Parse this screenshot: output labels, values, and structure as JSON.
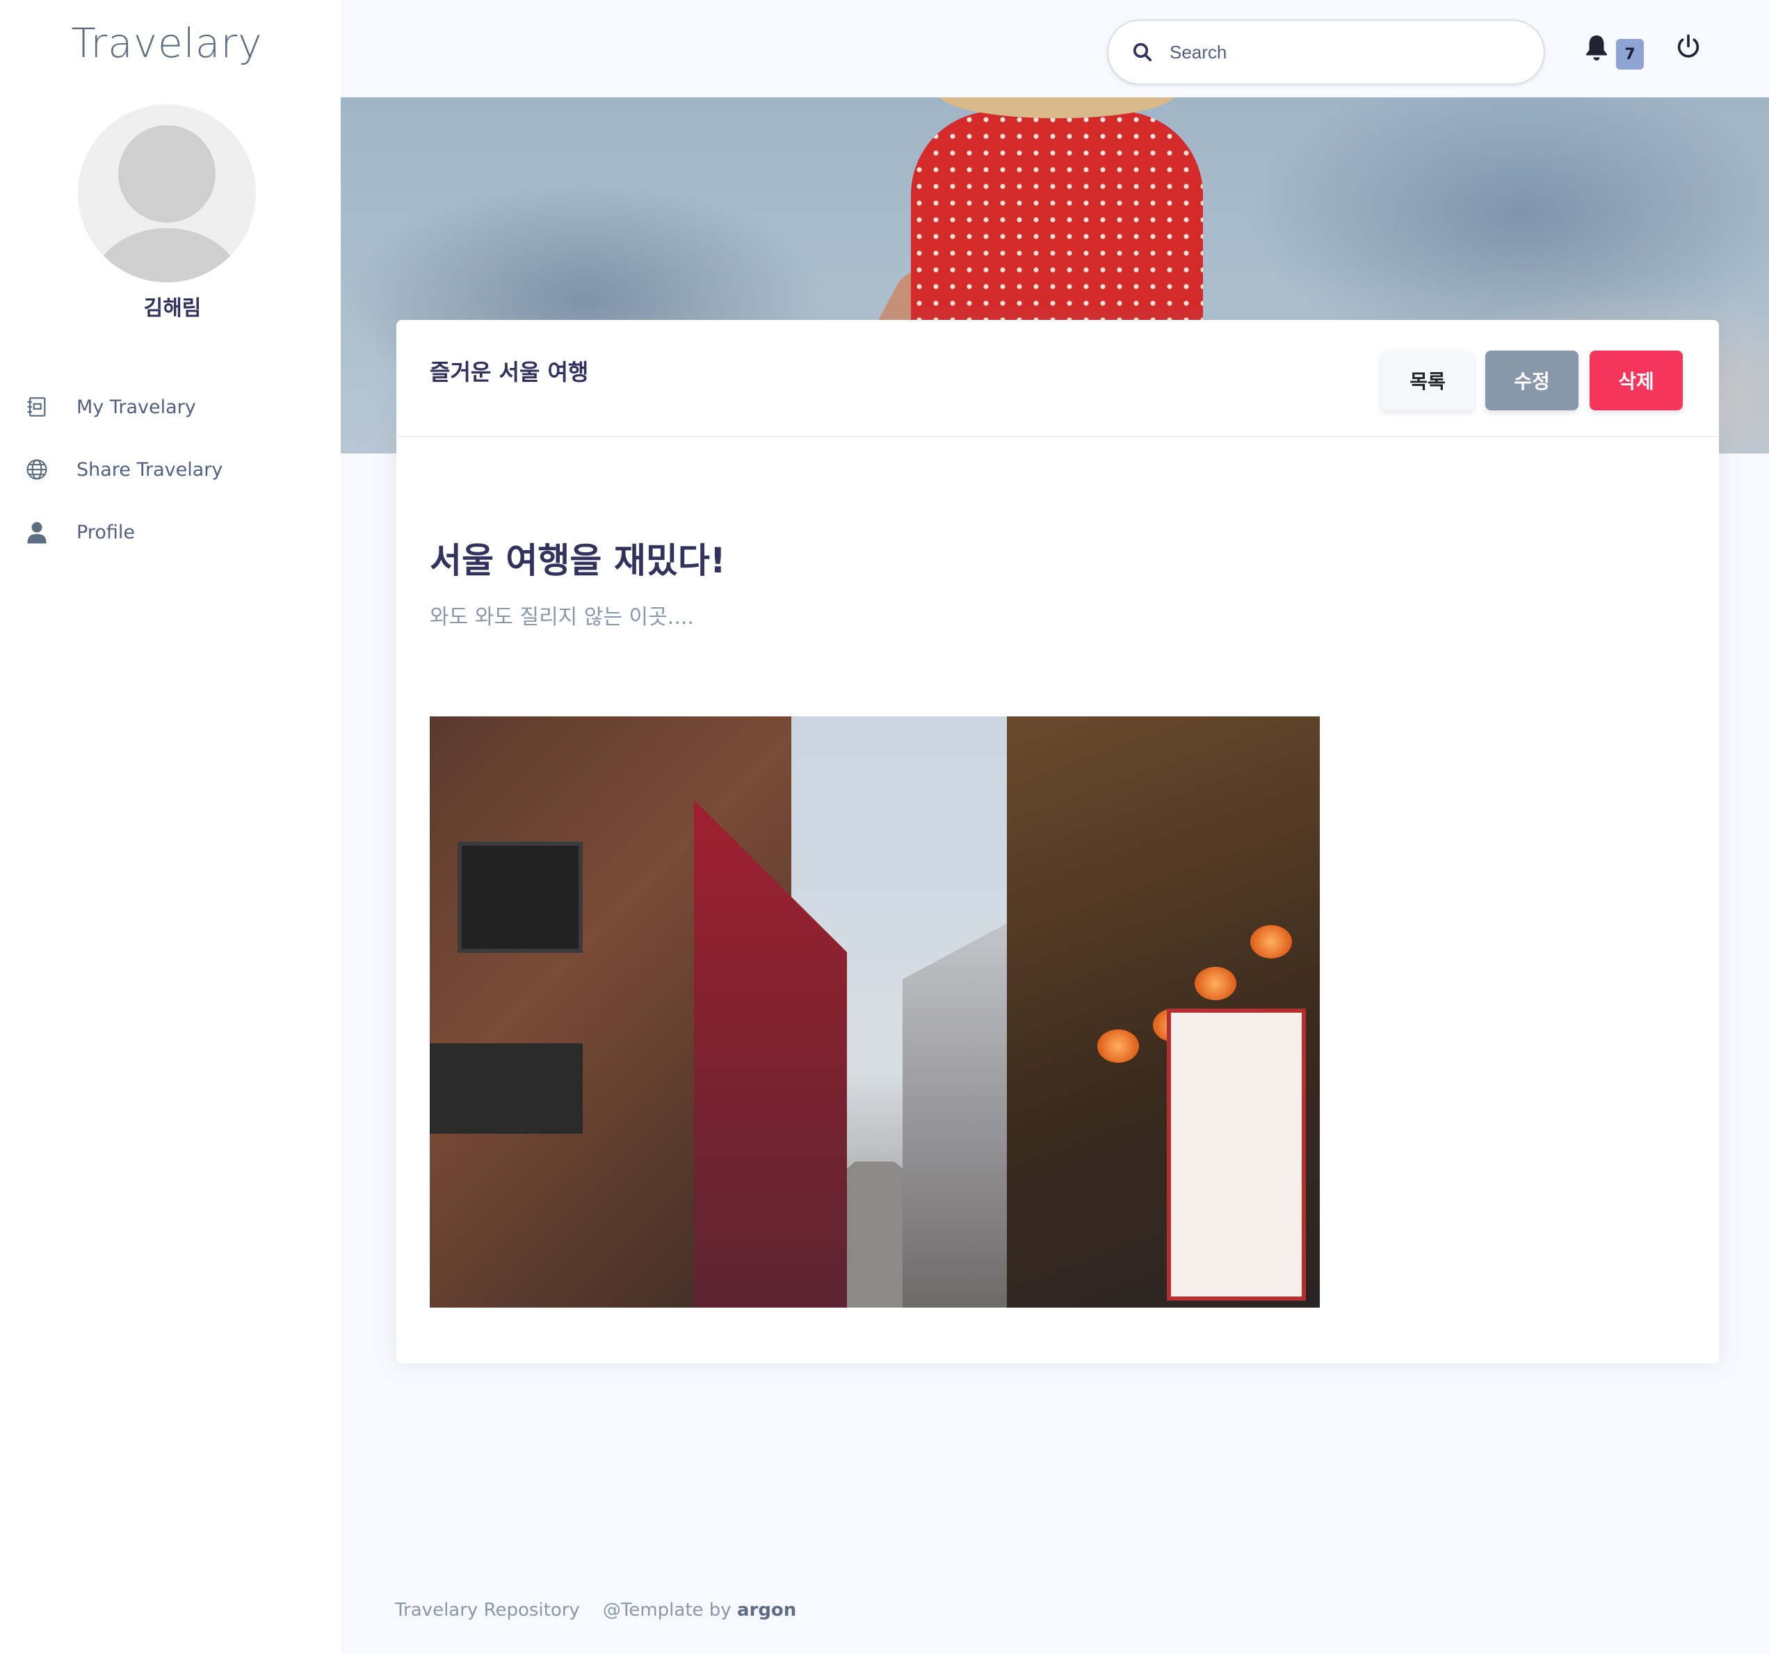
{
  "app": {
    "brand": "Travelary"
  },
  "user": {
    "name": "김해림"
  },
  "sidebar": {
    "items": [
      {
        "label": "My Travelary",
        "icon": "notebook-icon"
      },
      {
        "label": "Share Travelary",
        "icon": "globe-icon"
      },
      {
        "label": "Profile",
        "icon": "user-icon"
      }
    ]
  },
  "header": {
    "search_placeholder": "Search",
    "notifications_count": "7",
    "icons": {
      "search": "search-icon",
      "bell": "bell-icon",
      "power": "power-icon"
    }
  },
  "post": {
    "card_title": "즐거운 서울 여행",
    "title": "서울 여행을 재밌다!",
    "subtitle": "와도 와도 질리지 않는 이곳....",
    "actions": {
      "list": "목록",
      "edit": "수정",
      "delete": "삭제"
    }
  },
  "footer": {
    "repo": "Travelary Repository",
    "template_prefix": "@Template by",
    "template_name": "argon"
  },
  "colors": {
    "primary_text": "#32325d",
    "muted_text": "#8898aa",
    "danger": "#f5365c",
    "secondary": "#8898aa",
    "badge": "#8ea2d4"
  }
}
